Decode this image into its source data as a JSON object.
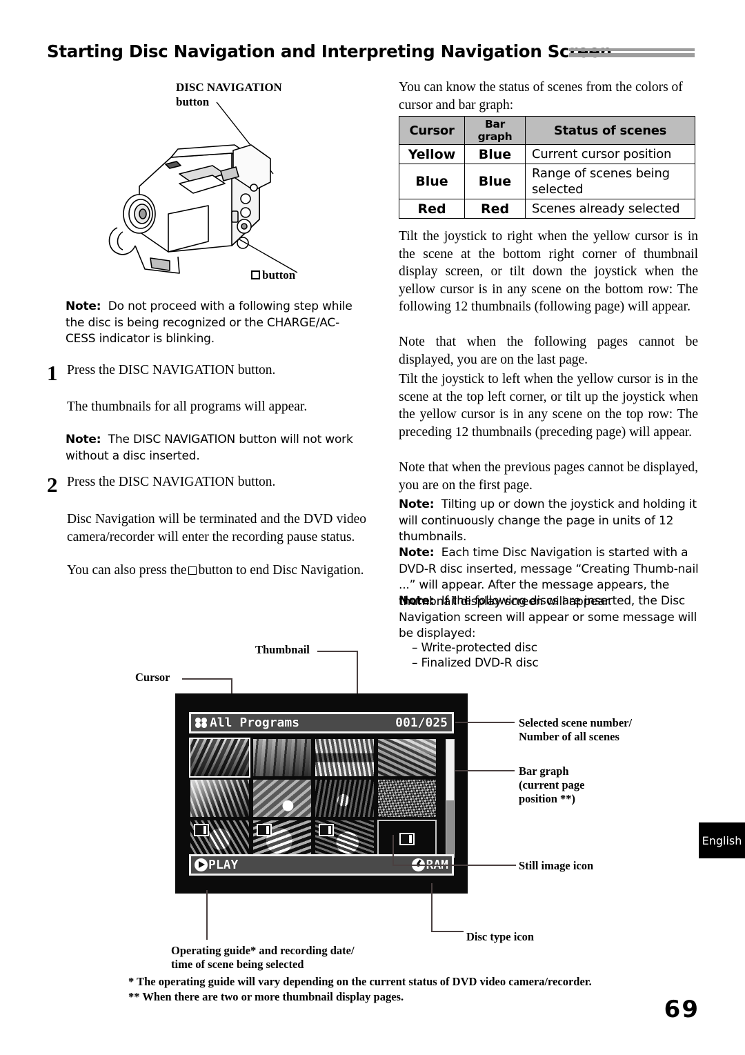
{
  "header": {
    "title": "Starting Disc Navigation and Interpreting Navigation Screen"
  },
  "left_column": {
    "camera_callout_line1": "DISC NAVIGATION",
    "camera_callout_line2": "button",
    "camera_callout_square_button": "button",
    "note_1_label": "Note:",
    "note_1_text": "Do not proceed with a following step while the disc is being recognized or the CHARGE/AC-CESS indicator is blinking.",
    "step_1_number": "1",
    "step_1_text": "Press the DISC NAVIGATION button.",
    "step_1_result": "The thumbnails for all programs will appear.",
    "note_2_label": "Note:",
    "note_2_text": "The DISC NAVIGATION button will not work without a disc inserted.",
    "step_2_number": "2",
    "step_2_text": "Press the DISC NAVIGATION button.",
    "step_2_result_a": "Disc Navigation will be terminated and the DVD video camera/recorder will enter the recording pause status.",
    "step_2_result_b_before": "You can also press the",
    "step_2_result_b_after": "button to end Disc Navigation."
  },
  "right_column": {
    "intro": "You can know the status of scenes from the colors of cursor and bar graph:",
    "table": {
      "headers": [
        "Cursor",
        "Bar graph",
        "Status of scenes"
      ],
      "rows": [
        {
          "cursor": "Yellow",
          "bar_graph": "Blue",
          "status": "Current cursor position"
        },
        {
          "cursor": "Blue",
          "bar_graph": "Blue",
          "status": "Range of scenes being selected"
        },
        {
          "cursor": "Red",
          "bar_graph": "Red",
          "status": "Scenes already selected"
        }
      ]
    },
    "para_1": "Tilt the joystick to right when the yellow cursor is in the scene at the bottom right corner of thumbnail display screen, or tilt down the joystick when the yellow cursor is in any scene on the bottom row: The following 12 thumbnails (following page) will appear.",
    "para_2": "Note that when the following pages cannot be displayed, you are on the last page.",
    "para_3": "Tilt the joystick to left when the yellow cursor is in the scene at the top left corner, or tilt up the joystick when the yellow cursor is in any scene on the top row: The preceding 12 thumbnails (preceding page) will appear.",
    "para_4": "Note that when the previous pages cannot be displayed, you are on the first page.",
    "note_3_label": "Note:",
    "note_3_text": "Tilting up or down the joystick and holding it will continuously change the page in units of 12 thumbnails.",
    "note_4_label": "Note:",
    "note_4_text": "Each time Disc Navigation is started with a DVD-R disc inserted, message “Creating Thumb-nail ...” will appear. After the message appears, the thumbnail display screen will appear.",
    "note_5_label": "Note:",
    "note_5_text": "If the following discs are inserted, the Disc Navigation screen will appear or some message will be displayed:",
    "note_5_items": [
      "– Write-protected disc",
      "– Finalized DVD-R disc"
    ]
  },
  "figure": {
    "label_thumbnail": "Thumbnail",
    "label_cursor": "Cursor",
    "label_scene_number": "Selected scene number/\nNumber of all scenes",
    "label_bar_graph": "Bar graph\n(current page\nposition **)",
    "label_still_image_icon": "Still image icon",
    "label_disc_type_icon": "Disc type icon",
    "label_operating_guide": "Operating guide* and recording date/\ntime of scene being selected",
    "screen": {
      "title": "All Programs",
      "counter": "001/025",
      "footer_left": "PLAY",
      "footer_right": "RAM",
      "program_icon": "all-programs-icon",
      "play_icon": "play-icon",
      "disc_icon": "disc-ram-icon",
      "thumbnail_count": 12,
      "cursor_index": 0,
      "still_image_indices": [
        8,
        9,
        10,
        11
      ]
    }
  },
  "footnotes": {
    "one": "*   The operating guide will vary depending on the current status of DVD video camera/recorder.",
    "two": "** When there are two or more thumbnail display pages."
  },
  "language_tab": "English",
  "page_number": "69"
}
